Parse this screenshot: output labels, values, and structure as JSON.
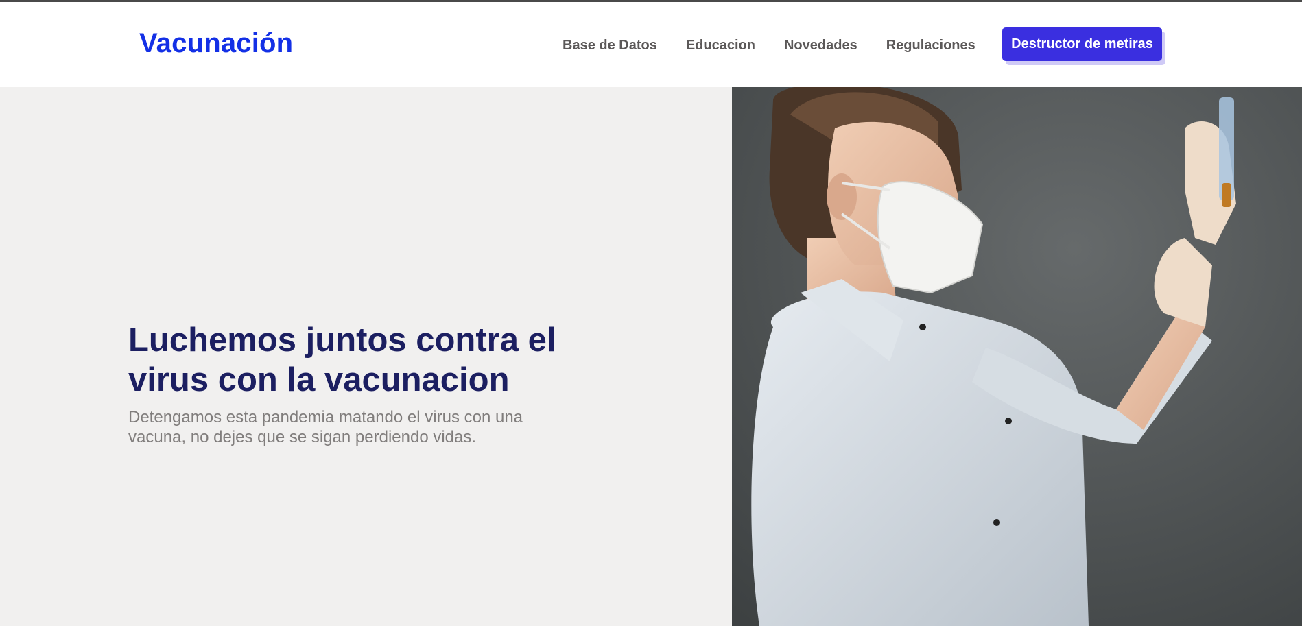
{
  "brand": {
    "name": "Vacunación",
    "color": "#1330e6"
  },
  "nav": {
    "links": [
      {
        "label": "Base de Datos"
      },
      {
        "label": "Educacion"
      },
      {
        "label": "Novedades"
      },
      {
        "label": "Regulaciones"
      }
    ],
    "cta_label": "Destructor de metiras",
    "cta_color": "#3a2fe0"
  },
  "hero": {
    "title": "Luchemos juntos contra el virus con la vacunacion",
    "subtitle": "Detengamos esta pandemia matando el virus con una vacuna, no dejes que se sigan perdiendo vidas.",
    "title_color": "#1c1f61",
    "image_description_icon": "nurse-with-vaccine-photo"
  },
  "colors": {
    "hero_left_bg": "#f1f0ef",
    "photo_bg": "#4d5152"
  }
}
